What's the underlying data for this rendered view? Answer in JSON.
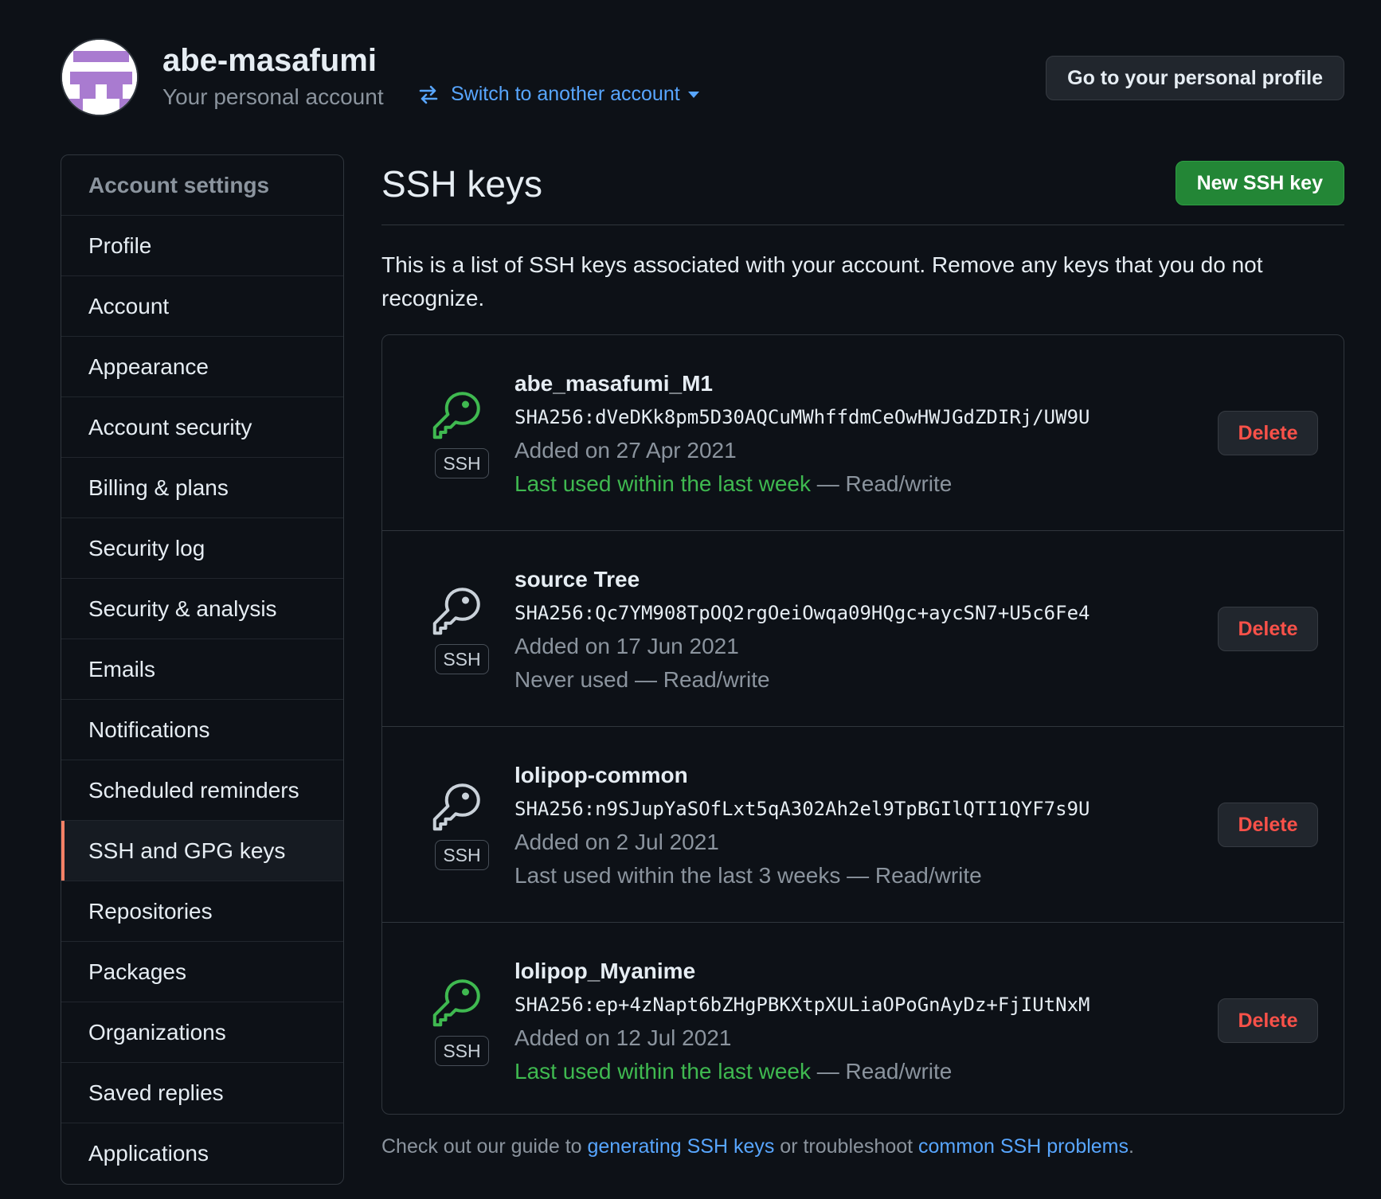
{
  "header": {
    "username": "abe-masafumi",
    "subtitle": "Your personal account",
    "switch_label": "Switch to another account",
    "profile_button": "Go to your personal profile"
  },
  "sidebar": {
    "heading": "Account settings",
    "active": "SSH and GPG keys",
    "items": [
      {
        "label": "Profile"
      },
      {
        "label": "Account"
      },
      {
        "label": "Appearance"
      },
      {
        "label": "Account security"
      },
      {
        "label": "Billing & plans"
      },
      {
        "label": "Security log"
      },
      {
        "label": "Security & analysis"
      },
      {
        "label": "Emails"
      },
      {
        "label": "Notifications"
      },
      {
        "label": "Scheduled reminders"
      },
      {
        "label": "SSH and GPG keys"
      },
      {
        "label": "Repositories"
      },
      {
        "label": "Packages"
      },
      {
        "label": "Organizations"
      },
      {
        "label": "Saved replies"
      },
      {
        "label": "Applications"
      }
    ]
  },
  "main": {
    "title": "SSH keys",
    "new_button": "New SSH key",
    "intro": "This is a list of SSH keys associated with your account. Remove any keys that you do not recognize.",
    "keys": [
      {
        "title": "abe_masafumi_M1",
        "fingerprint": "SHA256:dVeDKk8pm5D30AQCuMWhffdmCeOwHWJGdZDIRj/UW9U",
        "added": "Added on 27 Apr 2021",
        "usage": "Last used within the last week",
        "access": " — Read/write",
        "recent": true,
        "badge": "SSH",
        "delete_label": "Delete"
      },
      {
        "title": "source Tree",
        "fingerprint": "SHA256:Qc7YM908TpOQ2rgOeiOwqa09HQgc+aycSN7+U5c6Fe4",
        "added": "Added on 17 Jun 2021",
        "usage": "Never used",
        "access": " — Read/write",
        "recent": false,
        "badge": "SSH",
        "delete_label": "Delete"
      },
      {
        "title": "lolipop-common",
        "fingerprint": "SHA256:n9SJupYaSOfLxt5qA302Ah2el9TpBGIlQTI1QYF7s9U",
        "added": "Added on 2 Jul 2021",
        "usage": "Last used within the last 3 weeks",
        "access": " — Read/write",
        "recent": false,
        "badge": "SSH",
        "delete_label": "Delete"
      },
      {
        "title": "lolipop_Myanime",
        "fingerprint": "SHA256:ep+4zNapt6bZHgPBKXtpXULiaOPoGnAyDz+FjIUtNxM",
        "added": "Added on 12 Jul 2021",
        "usage": "Last used within the last week",
        "access": " — Read/write",
        "recent": true,
        "badge": "SSH",
        "delete_label": "Delete"
      }
    ],
    "footer": {
      "prefix": "Check out our guide to ",
      "link1": "generating SSH keys",
      "middle": " or troubleshoot ",
      "link2": "common SSH problems",
      "suffix": "."
    }
  },
  "colors": {
    "background": "#0d1117",
    "link": "#58a6ff",
    "success": "#3fb950",
    "danger": "#f85149",
    "active_indicator": "#f78166",
    "primary_button": "#238636"
  },
  "icons": {
    "switch": "arrows-switch-icon",
    "key": "key-icon",
    "caret": "caret-down-icon"
  }
}
